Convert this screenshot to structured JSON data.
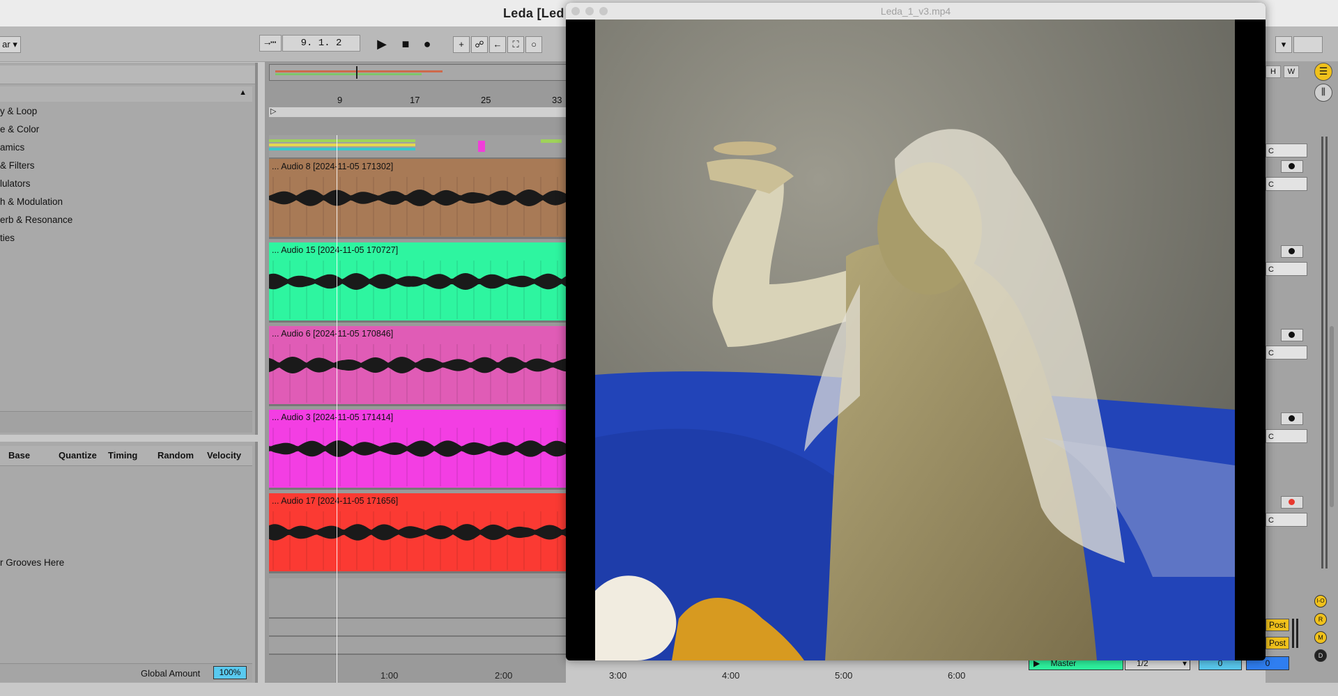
{
  "app": {
    "title": "Leda  [Led"
  },
  "control_bar": {
    "bars_dropdown": "ar",
    "follow_icon": "→⋯",
    "position": "9.   1.   2"
  },
  "browser": {
    "categories": [
      "y & Loop",
      "e & Color",
      "amics",
      "& Filters",
      "lulators",
      "h & Modulation",
      "erb & Resonance",
      "ties"
    ]
  },
  "groove_pool": {
    "headers": [
      "Base",
      "Quantize",
      "Timing",
      "Random",
      "Velocity"
    ],
    "drop_hint": "r Grooves Here",
    "global_amount_label": "Global Amount",
    "global_amount_value": "100%"
  },
  "arrangement": {
    "bar_markers": [
      "9",
      "17",
      "25",
      "33"
    ],
    "tracks": [
      {
        "label": "... Audio 8 [2024-11-05 171302]",
        "color": "#a87a56"
      },
      {
        "label": "... Audio 15 [2024-11-05 170727]",
        "color": "#2ef5a0"
      },
      {
        "label": "... Audio 6 [2024-11-05 170846]",
        "color": "#e05cb6"
      },
      {
        "label": "... Audio 3 [2024-11-05 171414]",
        "color": "#f33ee3"
      },
      {
        "label": "... Audio 17 [2024-11-05 171656]",
        "color": "#fb3a33"
      }
    ]
  },
  "video": {
    "title": "Leda_1_v3.mp4"
  },
  "time_ruler": [
    "1:00",
    "2:00",
    "3:00",
    "4:00",
    "5:00",
    "6:00"
  ],
  "mixer": {
    "h_btn": "H",
    "w_btn": "W",
    "slot_letter": "C",
    "master_label": "Master",
    "master_routing": "1/2",
    "post_label": "Post",
    "value_a": "0",
    "value_b": "0",
    "side_buttons": [
      "I-O",
      "R",
      "M",
      "D"
    ]
  },
  "colors": {
    "accent_yellow": "#f0c11b",
    "arm_red": "#e8392f",
    "cyan_field": "#59c9ef"
  }
}
